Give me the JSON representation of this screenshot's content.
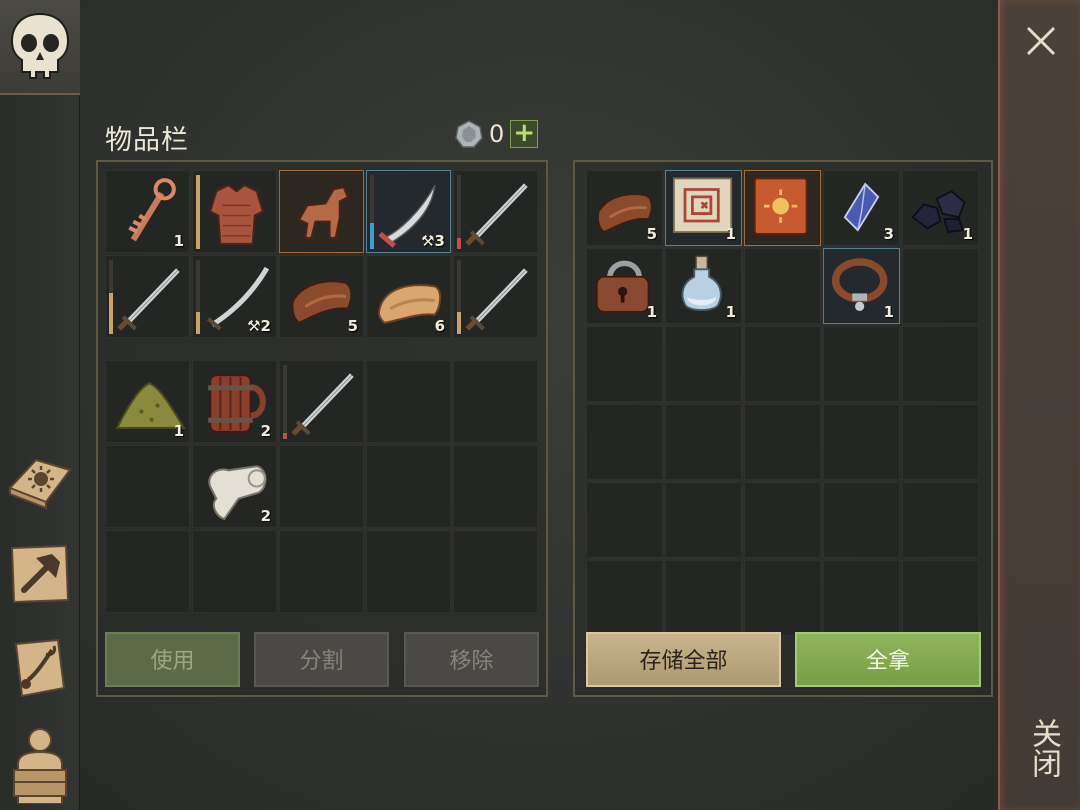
{
  "inventory": {
    "title": "物品栏",
    "currency_value": "0",
    "plus_label": "+",
    "equipped_rows": [
      [
        {
          "icon": "ornate-key-icon",
          "count": "1"
        },
        {
          "icon": "leather-armor-icon",
          "count": "",
          "durability": 1.0,
          "dur_color": "#c8a46a"
        },
        {
          "icon": "horse-figurine-icon",
          "count": "",
          "state": "selected-orange"
        },
        {
          "icon": "scimitar-icon",
          "count": "3",
          "count_prefix": "⚒",
          "durability": 0.35,
          "dur_color": "#3fa0c8",
          "state": "selected-blue"
        },
        {
          "icon": "sword-icon",
          "count": "",
          "durability": 0.15,
          "dur_color": "#c0504a"
        }
      ],
      [
        {
          "icon": "sword-icon",
          "count": "",
          "durability": 0.55,
          "dur_color": "#c8a46a"
        },
        {
          "icon": "curved-sword-icon",
          "count": "2",
          "count_prefix": "⚒",
          "durability": 0.3,
          "dur_color": "#c8a46a"
        },
        {
          "icon": "leather-icon",
          "count": "5"
        },
        {
          "icon": "cloth-icon",
          "count": "6"
        },
        {
          "icon": "sword-icon",
          "count": "",
          "durability": 0.3,
          "dur_color": "#c8a46a"
        }
      ]
    ],
    "bag_rows": [
      [
        {
          "icon": "sand-pile-icon",
          "count": "1"
        },
        {
          "icon": "wooden-mug-icon",
          "count": "2"
        },
        {
          "icon": "sword-icon",
          "count": "",
          "durability": 0.08,
          "dur_color": "#c0504a"
        },
        {
          "icon": "",
          "count": ""
        },
        {
          "icon": "",
          "count": ""
        }
      ],
      [
        {
          "icon": "",
          "count": ""
        },
        {
          "icon": "bandage-roll-icon",
          "count": "2"
        },
        {
          "icon": "",
          "count": ""
        },
        {
          "icon": "",
          "count": ""
        },
        {
          "icon": "",
          "count": ""
        }
      ],
      [
        {
          "icon": "",
          "count": ""
        },
        {
          "icon": "",
          "count": ""
        },
        {
          "icon": "",
          "count": ""
        },
        {
          "icon": "",
          "count": ""
        },
        {
          "icon": "",
          "count": ""
        }
      ]
    ],
    "buttons": {
      "use": "使用",
      "split": "分割",
      "remove": "移除"
    }
  },
  "container": {
    "rows": [
      [
        {
          "icon": "leather-icon",
          "count": "5"
        },
        {
          "icon": "treasure-map-icon",
          "count": "1",
          "state": "selected-blue"
        },
        {
          "icon": "sun-book-icon",
          "count": "",
          "state": "selected-orange"
        },
        {
          "icon": "crystal-icon",
          "count": "3"
        },
        {
          "icon": "coal-icon",
          "count": "1"
        }
      ],
      [
        {
          "icon": "padlock-icon",
          "count": "1"
        },
        {
          "icon": "potion-bottle-icon",
          "count": "1"
        },
        {
          "icon": "",
          "count": ""
        },
        {
          "icon": "leather-collar-icon",
          "count": "1",
          "state": "selected-blue"
        },
        {
          "icon": "",
          "count": ""
        }
      ],
      [
        {
          "icon": "",
          "count": ""
        },
        {
          "icon": "",
          "count": ""
        },
        {
          "icon": "",
          "count": ""
        },
        {
          "icon": "",
          "count": ""
        },
        {
          "icon": "",
          "count": ""
        }
      ],
      [
        {
          "icon": "",
          "count": ""
        },
        {
          "icon": "",
          "count": ""
        },
        {
          "icon": "",
          "count": ""
        },
        {
          "icon": "",
          "count": ""
        },
        {
          "icon": "",
          "count": ""
        }
      ],
      [
        {
          "icon": "",
          "count": ""
        },
        {
          "icon": "",
          "count": ""
        },
        {
          "icon": "",
          "count": ""
        },
        {
          "icon": "",
          "count": ""
        },
        {
          "icon": "",
          "count": ""
        }
      ],
      [
        {
          "icon": "",
          "count": ""
        },
        {
          "icon": "",
          "count": ""
        },
        {
          "icon": "",
          "count": ""
        },
        {
          "icon": "",
          "count": ""
        },
        {
          "icon": "",
          "count": ""
        }
      ]
    ],
    "buttons": {
      "store_all": "存储全部",
      "take_all": "全拿"
    }
  },
  "sidebar": {
    "items": [
      {
        "icon": "skull-icon"
      },
      {
        "icon": "sun-book-icon"
      },
      {
        "icon": "crafting-hammer-icon"
      },
      {
        "icon": "quest-scroll-icon"
      },
      {
        "icon": "character-backpack-icon"
      }
    ]
  },
  "close": {
    "label": "关闭",
    "icon": "close-icon"
  },
  "colors": {
    "accent_green": "#86ad52",
    "accent_tan": "#c0ad85",
    "selected_orange": "#a06a3a",
    "selected_blue": "#557f95"
  }
}
